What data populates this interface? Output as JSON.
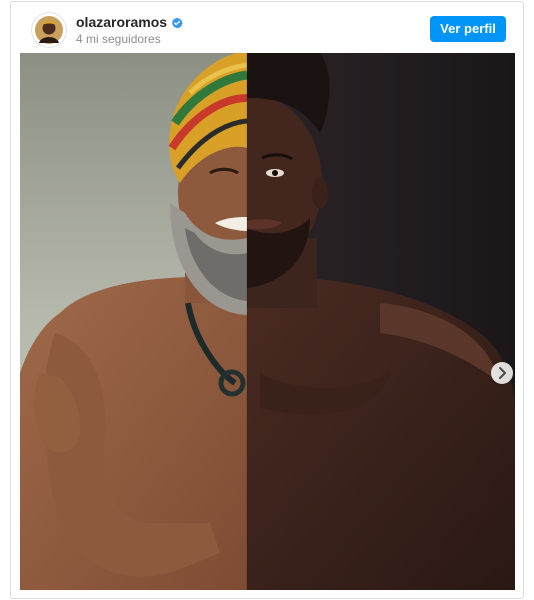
{
  "post": {
    "username": "olazaroramos",
    "followers_text": "4 mi seguidores",
    "view_profile_label": "Ver perfil",
    "verified": true,
    "media_description_icon": "split-portrait-photo",
    "carousel": {
      "total_slides": 3,
      "active_index": 0
    }
  },
  "colors": {
    "accent": "#0095f6",
    "username": "#262626",
    "secondary_text": "#8e8e8e",
    "border": "#dbdbdb"
  },
  "icons": {
    "avatar": "profile-avatar",
    "verified": "verified-badge-icon",
    "next": "chevron-right-icon"
  }
}
